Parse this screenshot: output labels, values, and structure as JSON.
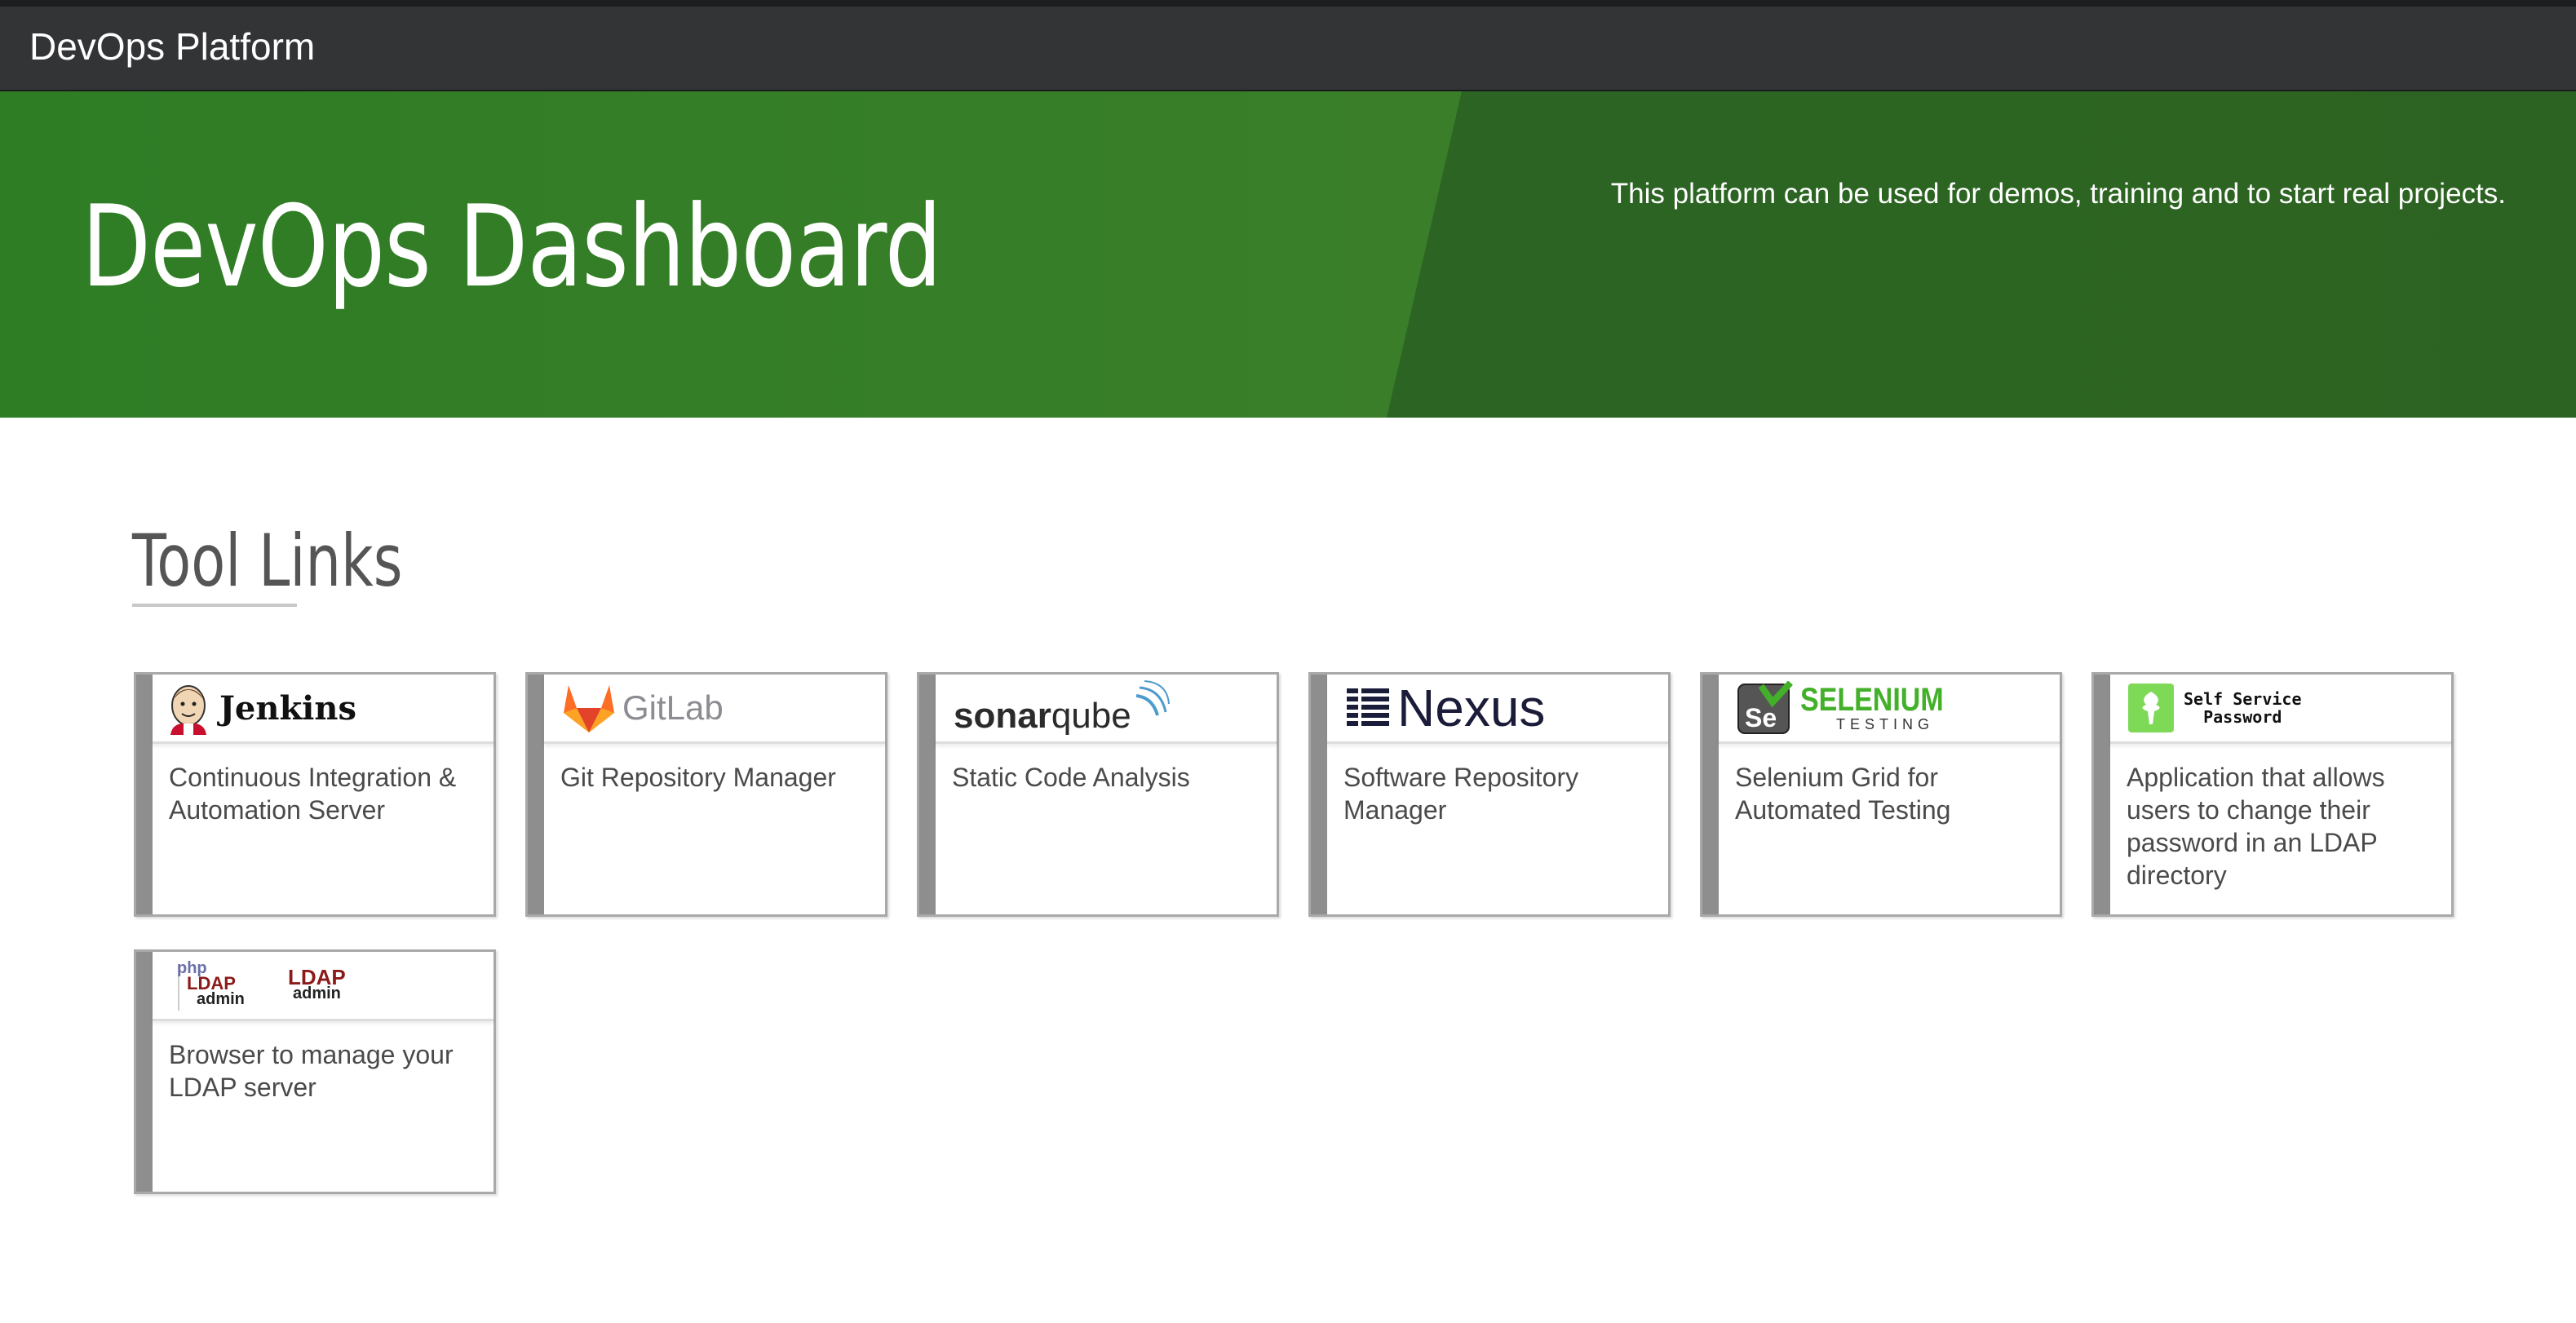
{
  "navbar": {
    "brand": "DevOps Platform"
  },
  "hero": {
    "title": "DevOps Dashboard",
    "tagline": "This platform can be used for demos, training and to start real projects."
  },
  "tools": {
    "section_title": "Tool Links",
    "cards": [
      {
        "logo_text": "Jenkins",
        "description": "Continuous Integration & Automation Server",
        "icon": "jenkins-logo-icon"
      },
      {
        "logo_text": "GitLab",
        "description": "Git Repository Manager",
        "icon": "gitlab-fox-icon"
      },
      {
        "logo_text_bold": "sonar",
        "logo_text": "qube",
        "description": "Static Code Analysis",
        "icon": "sonarqube-waves-icon"
      },
      {
        "logo_text": "Nexus",
        "description": "Software Repository Manager",
        "icon": "nexus-bars-icon"
      },
      {
        "logo_text": "SELENIUM",
        "logo_subtext": "TESTING",
        "description": "Selenium Grid for Automated Testing",
        "icon": "selenium-se-icon"
      },
      {
        "logo_text": "Self Service",
        "logo_subtext": "Password",
        "description": "Application that allows users to change their password in an LDAP directory",
        "icon": "self-service-password-tree-icon"
      },
      {
        "logo_text": "LDAP",
        "logo_subtext": "admin",
        "description": "Browser to manage your LDAP server",
        "icon": "phpldapadmin-icon"
      }
    ]
  },
  "colors": {
    "navbar": "#333436",
    "hero_green_left": "#3a7e29",
    "hero_green_right": "#2d6322",
    "selenium_green": "#43b02a",
    "gitlab_orange": "#e24329",
    "ldap_red": "#8b1a1a"
  }
}
